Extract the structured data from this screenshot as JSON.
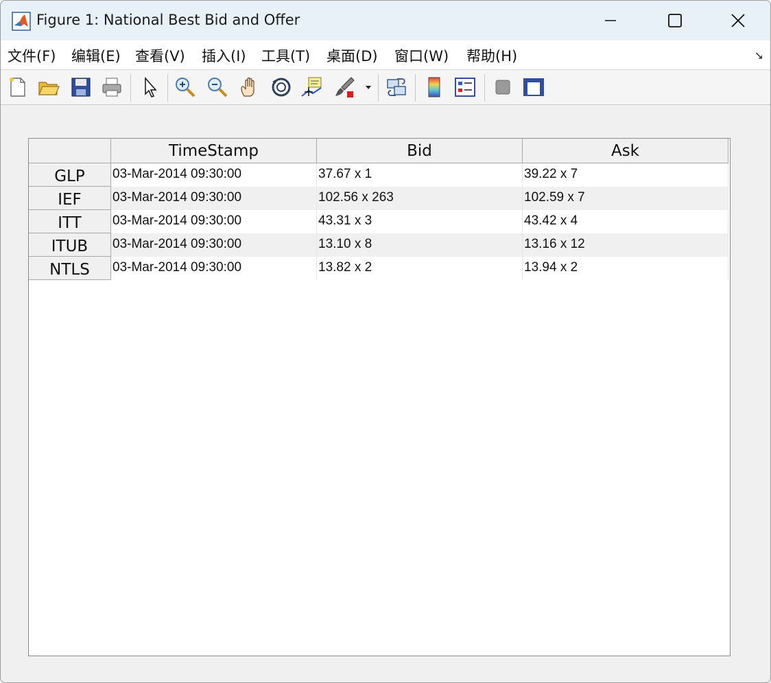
{
  "window": {
    "title": "Figure 1: National Best Bid and Offer"
  },
  "menu": [
    {
      "label": "文件(F)"
    },
    {
      "label": "编辑(E)"
    },
    {
      "label": "查看(V)"
    },
    {
      "label": "插入(I)"
    },
    {
      "label": "工具(T)"
    },
    {
      "label": "桌面(D)"
    },
    {
      "label": "窗口(W)"
    },
    {
      "label": "帮助(H)"
    }
  ],
  "toolbar": [
    "new-figure-icon",
    "open-file-icon",
    "save-icon",
    "print-icon",
    "edit-plot-arrow-icon",
    "zoom-in-icon",
    "zoom-out-icon",
    "pan-hand-icon",
    "rotate-3d-icon",
    "data-cursor-icon",
    "brush-icon",
    "brush-dropdown-icon",
    "link-plot-icon",
    "insert-colorbar-icon",
    "insert-legend-icon",
    "hide-plot-tools-icon",
    "show-plot-tools-icon"
  ],
  "table": {
    "columns": [
      "TimeStamp",
      "Bid",
      "Ask"
    ],
    "rows": [
      {
        "name": "GLP",
        "timestamp": "03-Mar-2014 09:30:00",
        "bid": "37.67 x 1",
        "ask": "39.22 x 7"
      },
      {
        "name": "IEF",
        "timestamp": "03-Mar-2014 09:30:00",
        "bid": "102.56 x 263",
        "ask": "102.59 x 7"
      },
      {
        "name": "ITT",
        "timestamp": "03-Mar-2014 09:30:00",
        "bid": "43.31 x 3",
        "ask": "43.42 x 4"
      },
      {
        "name": "ITUB",
        "timestamp": "03-Mar-2014 09:30:00",
        "bid": "13.10 x 8",
        "ask": "13.16 x 12"
      },
      {
        "name": "NTLS",
        "timestamp": "03-Mar-2014 09:30:00",
        "bid": "13.82 x 2",
        "ask": "13.94 x 2"
      }
    ]
  }
}
